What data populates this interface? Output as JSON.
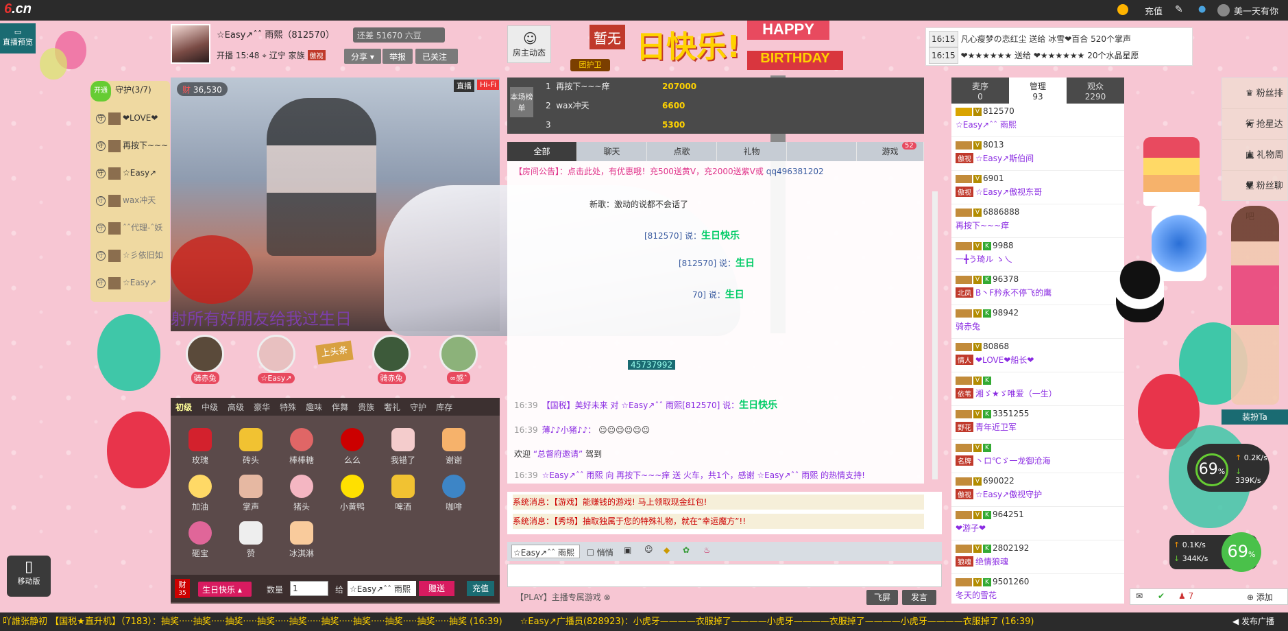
{
  "topbar": {
    "logo": "6.cn",
    "recharge": "充值",
    "username": "美一天有你"
  },
  "left": {
    "preview": "直播预览",
    "mobile": "移动版"
  },
  "anchor": {
    "name": "☆Easy↗ˆˆ 雨熙（812570）",
    "rank": "还差 51670 六豆",
    "open_time": "开播 15:48",
    "location": "辽宁",
    "family": "家族",
    "family_tag": "傲视",
    "share": "分享",
    "report": "举报",
    "followed": "已关注",
    "host_dyn": "房主动态"
  },
  "banner": {
    "zanwu": "暂无",
    "cn": "日快乐!",
    "happy": "HAPPY",
    "birthday": "BIRTHDAY",
    "team": "团护卫"
  },
  "gift_feed": [
    {
      "time": "16:15",
      "text": "凡心瘦梦の恋红尘 送给 冰雪❤百合 520个掌声"
    },
    {
      "time": "16:15",
      "text": "❤★★★★★★ 送给 ❤★★★★★★ 20个水晶星愿"
    }
  ],
  "guard": {
    "open": "开通",
    "title": "守护(3/7)",
    "items": [
      "❤LOVE❤",
      "再按下~~~",
      "☆Easy↗",
      "wax冲天",
      "ˆˆ代理-ˆ妖",
      "☆彡依旧如",
      "☆Easy↗"
    ]
  },
  "video": {
    "viewers": "36,530",
    "live": "直播",
    "hifi": "Hi-Fi",
    "marquee": "射所有好朋友给我过生日"
  },
  "fans": {
    "f1": "骑赤兔",
    "f2": "☆Easy↗",
    "headline": "上头条",
    "f3": "骑赤兔",
    "f4": "∞感ˆ"
  },
  "gift_tabs": [
    "初级",
    "中级",
    "高级",
    "豪华",
    "特殊",
    "趣味",
    "伴舞",
    "贵族",
    "奢礼",
    "守护",
    "库存"
  ],
  "gifts": [
    "玫瑰",
    "砖头",
    "棒棒糖",
    "么么",
    "我错了",
    "谢谢",
    "加油",
    "掌声",
    "猪头",
    "小黄鸭",
    "啤酒",
    "咖啡",
    "砸宝",
    "赞",
    "冰淇淋"
  ],
  "gift_bar": {
    "select": "生日快乐",
    "qty_label": "数量",
    "qty": "1",
    "to_label": "给",
    "to": "☆Easy↗ˆˆ 雨熙",
    "send": "赠送",
    "recharge": "充值",
    "badge": "35"
  },
  "rank": {
    "label": "本场榜单",
    "rows": [
      {
        "n": "1",
        "name": "再按下~~~痒",
        "amt": "207000"
      },
      {
        "n": "2",
        "name": "wax冲天",
        "amt": "6600"
      },
      {
        "n": "3",
        "name": "",
        "amt": "5300"
      }
    ]
  },
  "chat_tabs": [
    "全部",
    "聊天",
    "点歌",
    "礼物",
    "",
    "游戏"
  ],
  "chat_tab_badge": "52",
  "chat": {
    "notice": "【房间公告】：点击此处，有优惠哦！充500送黄V，充2000送紫V或",
    "notice_qq": "qq496381202",
    "song": "新歌：激动的说都不会话了",
    "l1": "[812570] 说：",
    "l1b": "生日快乐",
    "l2": "[812570] 说：",
    "l2b": "生日",
    "l3": "70] 说：",
    "l3b": "生日",
    "id_tag": "45737992",
    "m1t": "16:39",
    "m1": "【国税】美好未来 对 ☆Easy↗ˆˆ 雨熙[812570] 说：",
    "m1b": "生日快乐",
    "m2t": "16:39",
    "m2": "薄♪♪小猪♪♪：",
    "m3a": "欢迎",
    "m3b": "“总督府邀请”",
    "m3c": "驾到",
    "m4t": "16:39",
    "m4": "☆Easy↗ˆˆ 雨熙 向 再按下~~~痒 送 火车，共1个，感谢 ☆Easy↗ˆˆ 雨熙 的热情支持!"
  },
  "sys": [
    "系统消息：【游戏】能赚钱的游戏! 马上领取现金红包!",
    "系统消息：【秀场】抽取独属于您的特殊礼物，就在“幸运魔方”!!"
  ],
  "input": {
    "target": "☆Easy↗ˆˆ 雨熙",
    "whisper": "悄悄",
    "play": "【PLAY】主播专属游戏",
    "fly": "飞屏",
    "send": "发言"
  },
  "user_tabs": [
    {
      "label": "麦序",
      "count": "0"
    },
    {
      "label": "管理",
      "count": "93"
    },
    {
      "label": "观众",
      "count": "2290"
    }
  ],
  "users": [
    {
      "id": "812570",
      "name": "☆Easy↗ˆˆ 雨熙",
      "tag": ""
    },
    {
      "id": "8013",
      "name": "☆Easy↗斯伯间",
      "tag": "傲视"
    },
    {
      "id": "6901",
      "name": "☆Easy↗傲视东哥",
      "tag": "傲视"
    },
    {
      "id": "6886888",
      "name": "再按下~~~痒",
      "tag": ""
    },
    {
      "id": "9988",
      "name": "一╋う琦ル ゝ乀",
      "tag": ""
    },
    {
      "id": "96378",
      "name": "B丶F矜永不停飞的鹰",
      "tag": "北凤"
    },
    {
      "id": "98942",
      "name": "骑赤兔",
      "tag": ""
    },
    {
      "id": "80868",
      "name": "❤LOVE❤船长❤",
      "tag": "情人"
    },
    {
      "id": "",
      "name": "湘ゞ★ゞ唯爱（一生）",
      "tag": "依苇"
    },
    {
      "id": "3351255",
      "name": "青年近卫军",
      "tag": "野花"
    },
    {
      "id": "",
      "name": "丶ロ℃ゞ一龙御沧海",
      "tag": "名牌"
    },
    {
      "id": "690022",
      "name": "☆Easy↗傲视守护",
      "tag": "傲视"
    },
    {
      "id": "964251",
      "name": "❤游子❤",
      "tag": ""
    },
    {
      "id": "2802192",
      "name": "绝情狼魂",
      "tag": "狼魂"
    },
    {
      "id": "9501260",
      "name": "冬天的雪花",
      "tag": ""
    }
  ],
  "right_nav": [
    "粉丝排行",
    "抢星达人",
    "礼物周星",
    "粉丝聊吧"
  ],
  "dress": "装扮Ta",
  "speed": {
    "pct": "69",
    "unit": "%",
    "up": "0.2K/s",
    "down": "339K/s",
    "up2": "0.1K/s",
    "down2": "344K/s"
  },
  "bottom": {
    "count": "7",
    "add": "添加"
  },
  "ticker": "【国税★直升机】（7183）：抽奖·····抽奖·····抽奖·····抽奖·····抽奖·····抽奖·····抽奖·····抽奖·····抽奖·····抽奖 (16:39)　　☆Easy↗广播员(828923)：小虎牙————衣服掉了————小虎牙————衣服掉了————小虎牙————衣服掉了 (16:39)",
  "ticker_start": "吖誰张静初",
  "publish": "发布广播"
}
